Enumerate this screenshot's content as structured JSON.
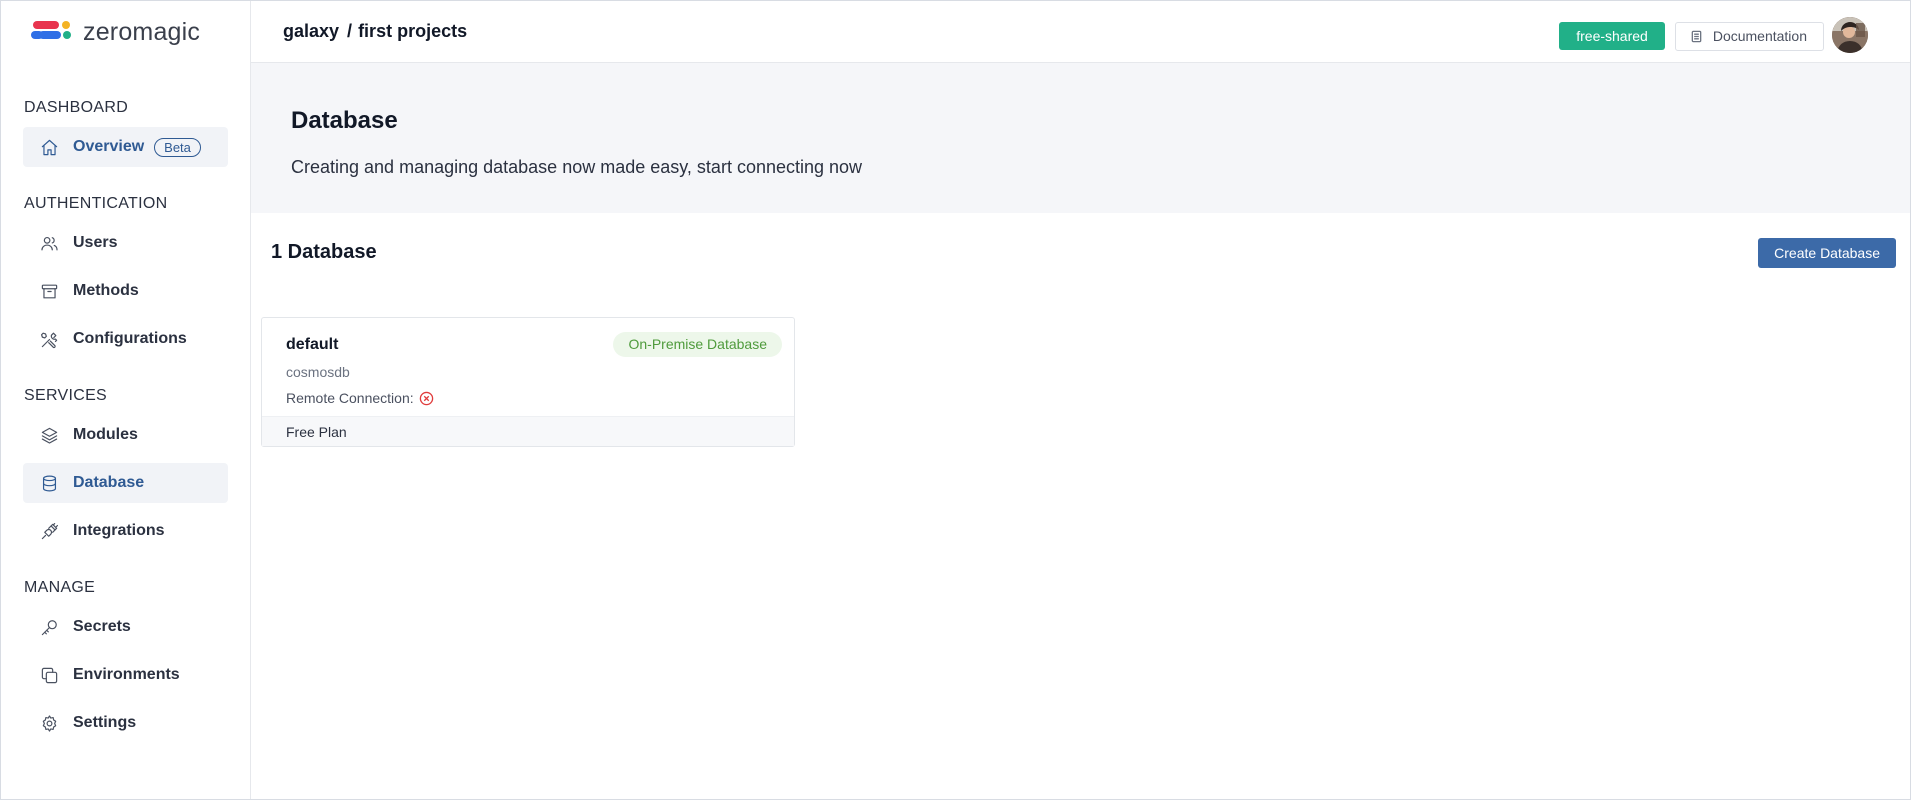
{
  "brand": {
    "name": "zeromagic",
    "colors": [
      "#e8344e",
      "#f4b324",
      "#2f6fe6",
      "#21b088"
    ]
  },
  "sidebar": {
    "sections": [
      {
        "title": "DASHBOARD",
        "items": [
          {
            "label": "Overview",
            "icon": "home-icon",
            "badge": "Beta",
            "active": false
          }
        ]
      },
      {
        "title": "AUTHENTICATION",
        "items": [
          {
            "label": "Users",
            "icon": "users-icon"
          },
          {
            "label": "Methods",
            "icon": "archive-icon"
          },
          {
            "label": "Configurations",
            "icon": "tools-icon"
          }
        ]
      },
      {
        "title": "SERVICES",
        "items": [
          {
            "label": "Modules",
            "icon": "layers-icon"
          },
          {
            "label": "Database",
            "icon": "database-icon",
            "active": true
          },
          {
            "label": "Integrations",
            "icon": "plug-icon"
          }
        ]
      },
      {
        "title": "MANAGE",
        "items": [
          {
            "label": "Secrets",
            "icon": "key-icon"
          },
          {
            "label": "Environments",
            "icon": "copy-icon"
          },
          {
            "label": "Settings",
            "icon": "gear-icon"
          }
        ]
      }
    ]
  },
  "header": {
    "workspace": "galaxy",
    "separator": "/",
    "project": "first projects",
    "plan_badge": "free-shared",
    "docs_label": "Documentation"
  },
  "hero": {
    "title": "Database",
    "subtitle": "Creating and managing database now made easy, start connecting now"
  },
  "list": {
    "count_label": "1 Database",
    "create_label": "Create Database"
  },
  "databases": [
    {
      "name": "default",
      "type": "cosmosdb",
      "remote_label": "Remote Connection:",
      "remote_status": "disabled",
      "tag": "On-Premise Database",
      "plan": "Free Plan"
    }
  ],
  "colors": {
    "accent": "#2f5a93",
    "primary_button": "#3c6aa8",
    "plan_badge": "#21b088",
    "tag_bg": "#edf7ea",
    "tag_text": "#4f9b3c",
    "error": "#e03b3b"
  }
}
